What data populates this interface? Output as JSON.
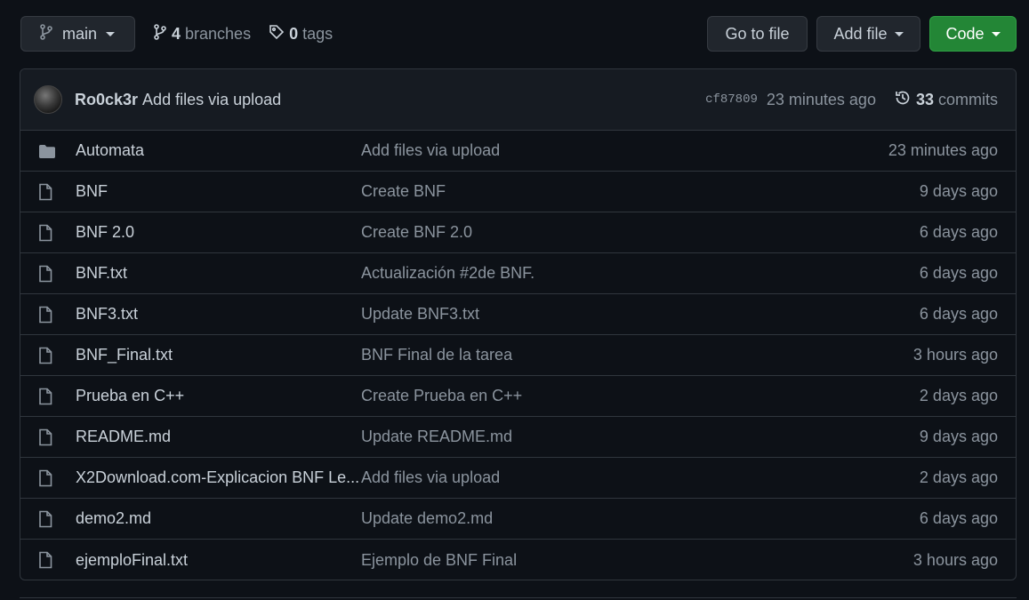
{
  "toolbar": {
    "branch": "main",
    "branches_count": "4",
    "branches_label": "branches",
    "tags_count": "0",
    "tags_label": "tags",
    "goto_file": "Go to file",
    "add_file": "Add file",
    "code": "Code"
  },
  "latest_commit": {
    "author": "Ro0ck3r",
    "message": "Add files via upload",
    "sha": "cf87809",
    "time": "23 minutes ago",
    "commits_count": "33",
    "commits_label": "commits"
  },
  "files": [
    {
      "type": "folder",
      "name": "Automata",
      "message": "Add files via upload",
      "age": "23 minutes ago"
    },
    {
      "type": "file",
      "name": "BNF",
      "message": "Create BNF",
      "age": "9 days ago"
    },
    {
      "type": "file",
      "name": "BNF 2.0",
      "message": "Create BNF 2.0",
      "age": "6 days ago"
    },
    {
      "type": "file",
      "name": "BNF.txt",
      "message": "Actualización #2de BNF.",
      "age": "6 days ago"
    },
    {
      "type": "file",
      "name": "BNF3.txt",
      "message": "Update BNF3.txt",
      "age": "6 days ago"
    },
    {
      "type": "file",
      "name": "BNF_Final.txt",
      "message": "BNF Final de la tarea",
      "age": "3 hours ago"
    },
    {
      "type": "file",
      "name": "Prueba en C++",
      "message": "Create Prueba en C++",
      "age": "2 days ago"
    },
    {
      "type": "file",
      "name": "README.md",
      "message": "Update README.md",
      "age": "9 days ago"
    },
    {
      "type": "file",
      "name": "X2Download.com-Explicacion BNF Le...",
      "message": "Add files via upload",
      "age": "2 days ago"
    },
    {
      "type": "file",
      "name": "demo2.md",
      "message": "Update demo2.md",
      "age": "6 days ago"
    },
    {
      "type": "file",
      "name": "ejemploFinal.txt",
      "message": "Ejemplo de BNF Final",
      "age": "3 hours ago"
    }
  ]
}
